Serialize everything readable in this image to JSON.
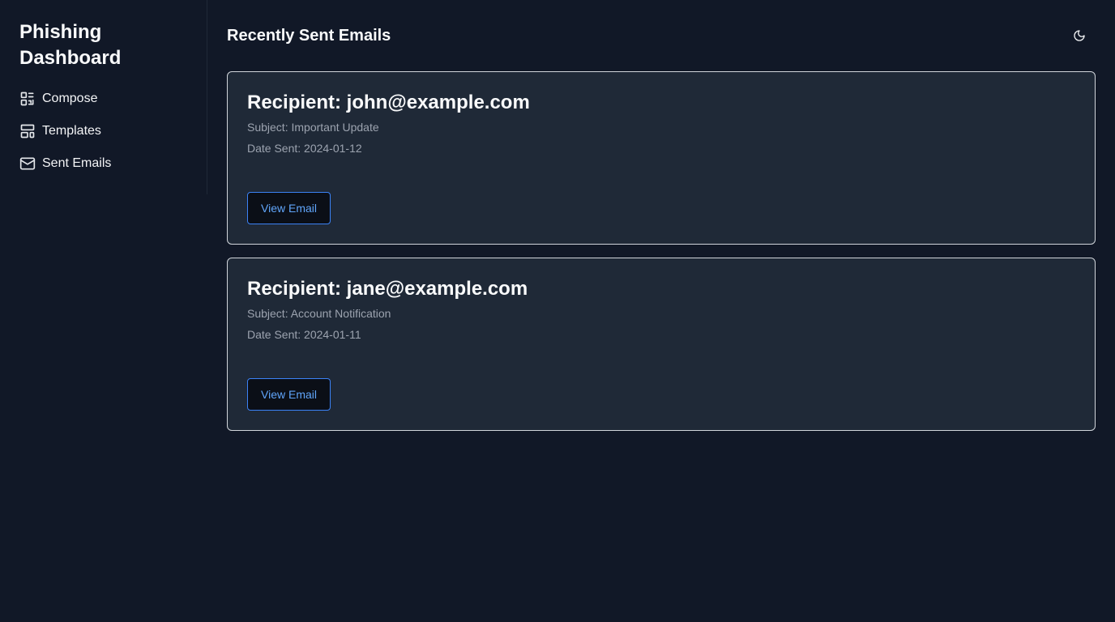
{
  "sidebar": {
    "brand": "Phishing Dashboard",
    "items": [
      {
        "label": "Compose",
        "icon": "compose-icon"
      },
      {
        "label": "Templates",
        "icon": "templates-icon"
      },
      {
        "label": "Sent Emails",
        "icon": "mail-icon"
      }
    ]
  },
  "header": {
    "title": "Recently Sent Emails",
    "theme_icon": "moon-icon"
  },
  "emails": [
    {
      "recipient": "Recipient: john@example.com",
      "subject": "Subject: Important Update",
      "date": "Date Sent: 2024-01-12",
      "button": "View Email"
    },
    {
      "recipient": "Recipient: jane@example.com",
      "subject": "Subject: Account Notification",
      "date": "Date Sent: 2024-01-11",
      "button": "View Email"
    }
  ],
  "colors": {
    "background": "#111827",
    "card": "#1f2937",
    "accent": "#60a5fa"
  }
}
